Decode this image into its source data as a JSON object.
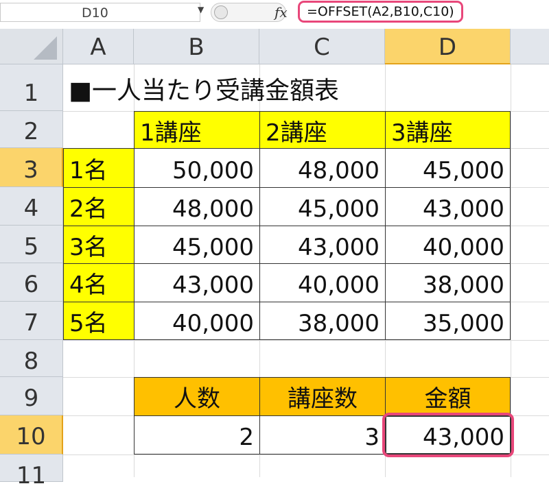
{
  "formula_bar": {
    "name_box": "D10",
    "fx_label": "fx",
    "formula": "=OFFSET(A2,B10,C10)"
  },
  "columns": [
    "A",
    "B",
    "C",
    "D"
  ],
  "rows": [
    "1",
    "2",
    "3",
    "4",
    "5",
    "6",
    "7",
    "8",
    "9",
    "10",
    "11"
  ],
  "selected": {
    "column": "D",
    "row": "10"
  },
  "sheet": {
    "title": "■一人当たり受講金額表",
    "course_headers": [
      "1講座",
      "2講座",
      "3講座"
    ],
    "people_labels": [
      "1名",
      "2名",
      "3名",
      "4名",
      "5名"
    ],
    "table": [
      [
        "50,000",
        "48,000",
        "45,000"
      ],
      [
        "48,000",
        "45,000",
        "43,000"
      ],
      [
        "45,000",
        "43,000",
        "40,000"
      ],
      [
        "43,000",
        "40,000",
        "38,000"
      ],
      [
        "40,000",
        "38,000",
        "35,000"
      ]
    ],
    "lookup_headers": [
      "人数",
      "講座数",
      "金額"
    ],
    "lookup_values": [
      "2",
      "3",
      "43,000"
    ]
  },
  "colors": {
    "header_yellow": "#ffff00",
    "lookup_orange": "#ffc000",
    "highlight_pink": "#e8477a",
    "selected_header": "#fbd46b"
  }
}
